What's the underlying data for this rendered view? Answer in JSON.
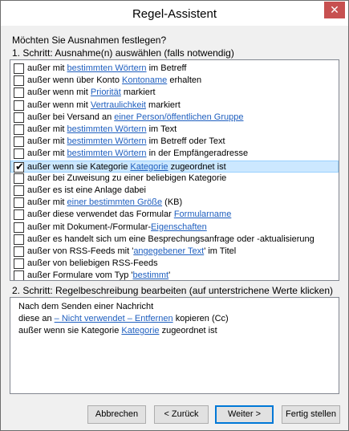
{
  "window": {
    "title": "Regel-Assistent",
    "close_glyph": "✕"
  },
  "question": "Möchten Sie Ausnahmen festlegen?",
  "step1_label": "1. Schritt: Ausnahme(n) auswählen (falls notwendig)",
  "step2_label": "2. Schritt: Regelbeschreibung bearbeiten (auf unterstrichene Werte klicken)",
  "exceptions": [
    {
      "checked": false,
      "pre": "außer mit ",
      "link": "bestimmten Wörtern",
      "post": " im Betreff"
    },
    {
      "checked": false,
      "pre": "außer wenn über Konto ",
      "link": "Kontoname",
      "post": " erhalten"
    },
    {
      "checked": false,
      "pre": "außer wenn mit ",
      "link": "Priorität",
      "post": " markiert"
    },
    {
      "checked": false,
      "pre": "außer wenn mit ",
      "link": "Vertraulichkeit",
      "post": " markiert"
    },
    {
      "checked": false,
      "pre": "außer bei Versand an ",
      "link": "einer Person/öffentlichen Gruppe",
      "post": ""
    },
    {
      "checked": false,
      "pre": "außer mit ",
      "link": "bestimmten Wörtern",
      "post": " im Text"
    },
    {
      "checked": false,
      "pre": "außer mit ",
      "link": "bestimmten Wörtern",
      "post": " im Betreff oder Text"
    },
    {
      "checked": false,
      "pre": "außer mit ",
      "link": "bestimmten Wörtern",
      "post": " in der Empfängeradresse"
    },
    {
      "checked": true,
      "pre": "außer wenn sie Kategorie ",
      "link": "Kategorie",
      "post": " zugeordnet ist"
    },
    {
      "checked": false,
      "pre": "außer bei Zuweisung zu einer beliebigen Kategorie",
      "link": "",
      "post": ""
    },
    {
      "checked": false,
      "pre": "außer es ist eine Anlage dabei",
      "link": "",
      "post": ""
    },
    {
      "checked": false,
      "pre": "außer mit ",
      "link": "einer bestimmten Größe",
      "post": " (KB)"
    },
    {
      "checked": false,
      "pre": "außer diese verwendet das Formular ",
      "link": "Formularname",
      "post": ""
    },
    {
      "checked": false,
      "pre": "außer mit Dokument-/Formular-",
      "link": "Eigenschaften",
      "post": ""
    },
    {
      "checked": false,
      "pre": "außer es handelt sich um eine Besprechungsanfrage oder -aktualisierung",
      "link": "",
      "post": ""
    },
    {
      "checked": false,
      "pre": "außer von RSS-Feeds mit '",
      "link": "angegebener Text",
      "post": "' im Titel"
    },
    {
      "checked": false,
      "pre": "außer von beliebigen RSS-Feeds",
      "link": "",
      "post": ""
    },
    {
      "checked": false,
      "pre": "außer Formulare vom Typ '",
      "link": "bestimmt",
      "post": "'"
    }
  ],
  "selected_index": 8,
  "checkmark_glyph": "✔",
  "description": {
    "line1": "Nach dem Senden einer Nachricht",
    "line2_pre": "diese an ",
    "line2_link": "– Nicht verwendet – Entfernen",
    "line2_post": " kopieren (Cc)",
    "line3_pre": "außer wenn sie Kategorie ",
    "line3_link": "Kategorie",
    "line3_post": " zugeordnet ist"
  },
  "buttons": {
    "cancel": "Abbrechen",
    "back": "< Zurück",
    "next": "Weiter >",
    "finish": "Fertig stellen"
  },
  "colors": {
    "link": "#1f5fbf",
    "selection_bg": "#cce8ff",
    "close_bg": "#c75050"
  }
}
